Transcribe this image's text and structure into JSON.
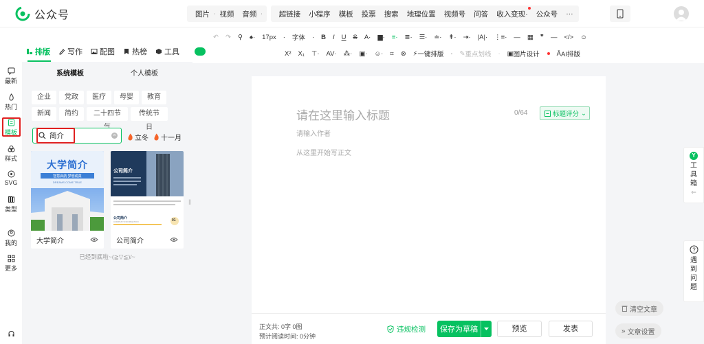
{
  "app": {
    "title": "公众号"
  },
  "topnav": {
    "media": [
      "图片",
      "视频",
      "音频"
    ],
    "insert": [
      "超链接",
      "小程序",
      "模板",
      "投票",
      "搜索",
      "地理位置",
      "视频号",
      "问答",
      "收入变现",
      "公众号"
    ],
    "more": "···"
  },
  "rail": {
    "items": [
      "最新",
      "热门",
      "模板",
      "样式",
      "SVG",
      "类型",
      "我的",
      "更多"
    ],
    "active": "模板"
  },
  "panel_tabs": [
    "排版",
    "写作",
    "配图",
    "热榜",
    "工具"
  ],
  "panel": {
    "subtabs": [
      "系统模板",
      "个人模板"
    ],
    "tags": [
      "企业",
      "党政",
      "医疗",
      "母婴",
      "教育",
      "新闻",
      "简约",
      "二十四节气",
      "传统节日"
    ],
    "search": {
      "value": "简介"
    },
    "festivals": [
      "立冬",
      "十一月"
    ],
    "cards": [
      {
        "name": "大学简介",
        "thumb_title": "大学简介",
        "thumb_sub": "智慧启航 梦想成真",
        "thumb_en": "DREAMS COME TRUE"
      },
      {
        "name": "公司简介",
        "thumb_title": "公司简介",
        "thumb_sub": "公司简介",
        "thumb_en": "COMPANY INFORMATION",
        "thumb_num": "01"
      }
    ],
    "end_text": "已经到底啦~(≧▽≦)/~"
  },
  "toolbar": {
    "font_size": "17px",
    "font_family": "字体",
    "one_click_format": "一键排版",
    "highlight_line": "重点划线",
    "image_design": "图片设计",
    "ai_format": "AI排版"
  },
  "editor": {
    "title_placeholder": "请在这里输入标题",
    "title_count": "0/64",
    "title_score": "标题评分",
    "author_placeholder": "请输入作者",
    "body_placeholder": "从这里开始写正文"
  },
  "footer": {
    "stats_line1": "正文共:  0字 0图",
    "stats_line2": "预计阅读时间:  0分钟",
    "check_label": "违规检测",
    "save_label": "保存为草稿",
    "preview_label": "预览",
    "publish_label": "发表"
  },
  "side": {
    "toolbox": "工具箱",
    "help": "遇到问题",
    "clear": "清空文章",
    "settings": "文章设置"
  },
  "colors": {
    "accent": "#07c160",
    "highlight_box": "#e02020"
  }
}
